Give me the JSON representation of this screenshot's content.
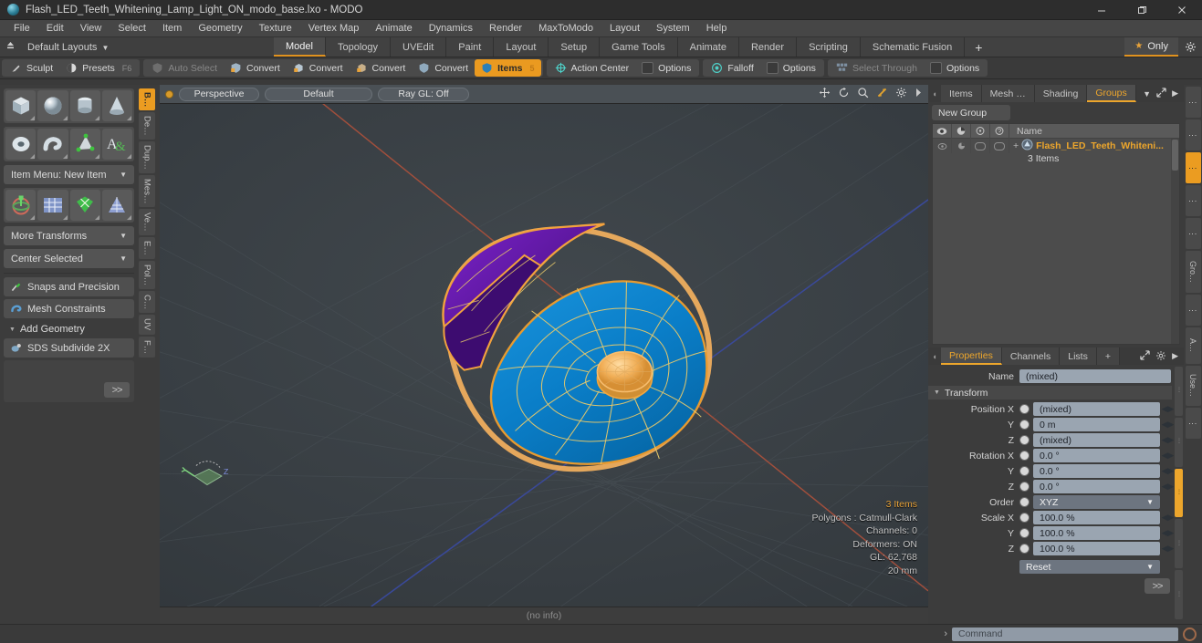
{
  "window": {
    "title": "Flash_LED_Teeth_Whitening_Lamp_Light_ON_modo_base.lxo - MODO",
    "minimize": "—",
    "maximize": "❐",
    "close": "✕"
  },
  "menubar": {
    "items": [
      "File",
      "Edit",
      "View",
      "Select",
      "Item",
      "Geometry",
      "Texture",
      "Vertex Map",
      "Animate",
      "Dynamics",
      "Render",
      "MaxToModo",
      "Layout",
      "System",
      "Help"
    ]
  },
  "layoutbar": {
    "default_layouts": "Default Layouts",
    "tabs": [
      {
        "label": "Model",
        "active": true
      },
      {
        "label": "Topology",
        "active": false
      },
      {
        "label": "UVEdit",
        "active": false
      },
      {
        "label": "Paint",
        "active": false
      },
      {
        "label": "Layout",
        "active": false
      },
      {
        "label": "Setup",
        "active": false
      },
      {
        "label": "Game Tools",
        "active": false
      },
      {
        "label": "Animate",
        "active": false
      },
      {
        "label": "Render",
        "active": false
      },
      {
        "label": "Scripting",
        "active": false
      },
      {
        "label": "Schematic Fusion",
        "active": false
      }
    ],
    "add_tab": "+",
    "only_label": "Only"
  },
  "modebar": {
    "sculpt": "Sculpt",
    "presets": "Presets",
    "presets_hotkey": "F6",
    "auto_select": "Auto Select",
    "convert1": "Convert",
    "convert2": "Convert",
    "convert3": "Convert",
    "convert4": "Convert",
    "items": "Items",
    "items_hotkey": "5",
    "action_center": "Action Center",
    "options1": "Options",
    "falloff": "Falloff",
    "options2": "Options",
    "select_through": "Select Through",
    "options3": "Options"
  },
  "left_toolbox": {
    "primitives_row1": [
      "cube-primitive",
      "sphere-primitive",
      "cylinder-primitive",
      "cone-primitive"
    ],
    "primitives_row2": [
      "torus-primitive",
      "tube-primitive",
      "pen-tool",
      "text-tool"
    ],
    "item_menu": "Item Menu: New Item",
    "transform_row": [
      "transform-gizmo",
      "bend-tool",
      "smooth-shift",
      "falloff-tool"
    ],
    "more_transforms": "More Transforms",
    "center_selected": "Center Selected",
    "snaps_and_precision": "Snaps and Precision",
    "mesh_constraints": "Mesh Constraints",
    "add_geometry": "Add Geometry",
    "sds_subdivide": "SDS Subdivide 2X",
    "expand_button": ">>",
    "vtabs": [
      {
        "label": "B…",
        "active": true
      },
      {
        "label": "De…",
        "active": false
      },
      {
        "label": "Dup…",
        "active": false
      },
      {
        "label": "Mes…",
        "active": false
      },
      {
        "label": "Ve…",
        "active": false
      },
      {
        "label": "E…",
        "active": false
      },
      {
        "label": "Pol…",
        "active": false
      },
      {
        "label": "C…",
        "active": false
      },
      {
        "label": "UV",
        "active": false
      },
      {
        "label": "F…",
        "active": false
      }
    ]
  },
  "viewport": {
    "projection": "Perspective",
    "shading": "Default",
    "raygl": "Ray GL: Off",
    "tools": [
      "move-icon",
      "rotate-icon",
      "zoom-icon",
      "fit-icon",
      "gear-icon",
      "chevron-right-icon"
    ],
    "info": {
      "items": "3 Items",
      "polygons": "Polygons : Catmull-Clark",
      "channels": "Channels: 0",
      "deformers": "Deformers: ON",
      "gl": "GL: 62,768",
      "scale": "20 mm"
    },
    "footer": "(no info)"
  },
  "right_panel": {
    "tabs": [
      {
        "label": "Items",
        "active": false
      },
      {
        "label": "Mesh …",
        "active": false
      },
      {
        "label": "Shading",
        "active": false
      },
      {
        "label": "Groups",
        "active": true
      }
    ],
    "new_group": "New Group",
    "list_header": {
      "eye": "visibility-icon",
      "render": "render-icon",
      "lock": "lock-icon",
      "info": "info-icon",
      "name": "Name"
    },
    "rows": [
      {
        "name": "Flash_LED_Teeth_Whiteni...",
        "sub": "3 Items"
      }
    ],
    "vtabs": [
      {
        "label": "⋮",
        "active": false
      },
      {
        "label": "⋮",
        "active": false
      },
      {
        "label": "⋮",
        "active": true
      },
      {
        "label": "⋮",
        "active": false
      },
      {
        "label": "⋮",
        "active": false
      },
      {
        "label": "Gro…",
        "active": false
      },
      {
        "label": "⋮",
        "active": false
      },
      {
        "label": "A…",
        "active": false
      },
      {
        "label": "Use…",
        "active": false
      },
      {
        "label": "⋮",
        "active": false
      }
    ]
  },
  "properties": {
    "tabs": [
      {
        "label": "Properties",
        "active": true
      },
      {
        "label": "Channels",
        "active": false
      },
      {
        "label": "Lists",
        "active": false
      },
      {
        "label": "+",
        "active": false
      }
    ],
    "name_label": "Name",
    "name_value": "(mixed)",
    "transform_section": "Transform",
    "fields": [
      {
        "label": "Position X",
        "value": "(mixed)",
        "type": "num"
      },
      {
        "label": "Y",
        "value": "0 m",
        "type": "num"
      },
      {
        "label": "Z",
        "value": "(mixed)",
        "type": "num"
      },
      {
        "label": "Rotation X",
        "value": "0.0 °",
        "type": "num"
      },
      {
        "label": "Y",
        "value": "0.0 °",
        "type": "num"
      },
      {
        "label": "Z",
        "value": "0.0 °",
        "type": "num"
      },
      {
        "label": "Order",
        "value": "XYZ",
        "type": "drop"
      },
      {
        "label": "Scale X",
        "value": "100.0 %",
        "type": "num"
      },
      {
        "label": "Y",
        "value": "100.0 %",
        "type": "num"
      },
      {
        "label": "Z",
        "value": "100.0 %",
        "type": "num"
      }
    ],
    "reset_label": "Reset",
    "expand_button": ">>"
  },
  "statusbar": {
    "info": "(no info)",
    "command_placeholder": "Command",
    "arrow": "›"
  },
  "colors": {
    "accent": "#eda62c",
    "mesh_blue": "#0a7ec8",
    "mesh_wire": "#e8c96a",
    "selection": "#f3a63c",
    "purple": "#6e1fb4",
    "axis_x": "#a8503c",
    "axis_z": "#3a4a9e"
  }
}
